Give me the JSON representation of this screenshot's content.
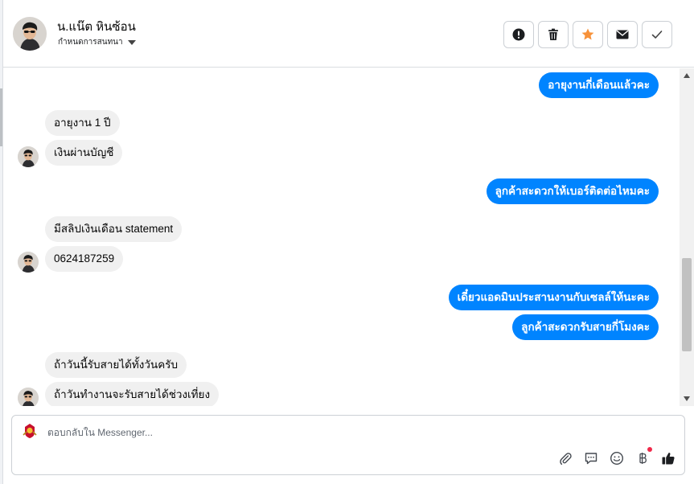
{
  "header": {
    "contact_name": "น.แน๊ต หินซ้อน",
    "status": "กำหนดการสนทนา",
    "actions": [
      {
        "icon": "alert-icon",
        "name": "mark-spam-button"
      },
      {
        "icon": "trash-icon",
        "name": "delete-button"
      },
      {
        "icon": "star-icon",
        "name": "star-button"
      },
      {
        "icon": "envelope-icon",
        "name": "mark-unread-button"
      },
      {
        "icon": "check-icon",
        "name": "mark-done-button"
      }
    ]
  },
  "messages": [
    {
      "side": "out",
      "text": "อายุงานกี่เดือนแล้วคะ"
    },
    {
      "side": "in",
      "text": "อายุงาน 1 ปี"
    },
    {
      "side": "in",
      "text": "เงินผ่านบัญชี"
    },
    {
      "side": "out",
      "text": "ลูกค้าสะดวกให้เบอร์ติดต่อไหมคะ"
    },
    {
      "side": "in",
      "text": "มีสลิปเงินเดือน statement"
    },
    {
      "side": "in",
      "text": "0624187259"
    },
    {
      "side": "out",
      "text": "เดี๋ยวแอดมินประสานงานกับเซลล์ให้นะคะ"
    },
    {
      "side": "out",
      "text": "ลูกค้าสะดวกรับสายกี่โมงคะ"
    },
    {
      "side": "in",
      "text": "ถ้าวันนี้รับสายได้ทั้งวันครับ"
    },
    {
      "side": "in",
      "text": "ถ้าวันทำงานจะรับสายได้ช่วงเที่ยง"
    }
  ],
  "composer": {
    "placeholder": "ตอบกลับใน Messenger...",
    "tools": [
      "paperclip-icon",
      "saved-reply-icon",
      "emoji-icon",
      "baht-icon",
      "thumbs-up-icon"
    ]
  },
  "colors": {
    "outgoing_bubble": "#0084ff",
    "incoming_bubble": "#f0f0f0",
    "star": "#f7923a",
    "notification_dot": "#f02849"
  }
}
